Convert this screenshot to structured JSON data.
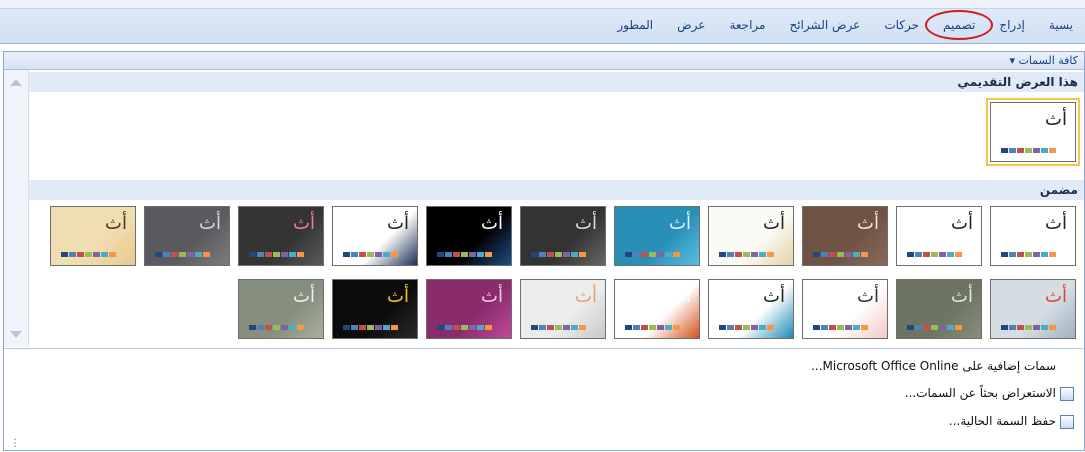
{
  "ribbon": {
    "tabs": [
      {
        "id": "home",
        "label": "يسية"
      },
      {
        "id": "insert",
        "label": "إدراج"
      },
      {
        "id": "design",
        "label": "تصميم"
      },
      {
        "id": "animations",
        "label": "حركات"
      },
      {
        "id": "slideshow",
        "label": "عرض الشرائح"
      },
      {
        "id": "review",
        "label": "مراجعة"
      },
      {
        "id": "view",
        "label": "عرض"
      },
      {
        "id": "developer",
        "label": "المطور"
      }
    ],
    "active_tab": "تصميم",
    "highlight_color": "#d01c1c"
  },
  "gallery": {
    "header": "كافة السمات ▾",
    "section_this": "هذا العرض التقديمي",
    "section_builtin": "مضمن",
    "theme_glyph": "أث"
  },
  "themes_row1": [
    {
      "bg": "#ffffff",
      "fg": "#222222",
      "accent": "#ffffff"
    },
    {
      "bg": "#ffffff",
      "fg": "#222222",
      "accent": "#ffffff"
    },
    {
      "bg": "#6f5446",
      "fg": "#f0e6dc",
      "accent": "#8a6a58"
    },
    {
      "bg": "#fbfbf6",
      "fg": "#222222",
      "accent": "#e3d2a4"
    },
    {
      "bg": "#2a8fb6",
      "fg": "#dff3fb",
      "accent": "#58c0e2"
    },
    {
      "bg": "#333333",
      "fg": "#dddddd",
      "accent": "#666666"
    },
    {
      "bg": "#000000",
      "fg": "#ffffff",
      "accent": "#1f4e85"
    },
    {
      "bg": "#ffffff",
      "fg": "#222222",
      "accent": "#1c2f57"
    },
    {
      "bg": "#343434",
      "fg": "#e87fa0",
      "accent": "#5a5a5a"
    },
    {
      "bg": "#5b5b5f",
      "fg": "#d8d8d8",
      "accent": "#7b7b80"
    },
    {
      "bg": "#f1ddb2",
      "fg": "#4a3a22",
      "accent": "#e6c88a"
    }
  ],
  "themes_row2": [
    {
      "bg": "#d5dde3",
      "fg": "#e14040",
      "accent": "#9fb1bf"
    },
    {
      "bg": "#6e7462",
      "fg": "#e6e6da",
      "accent": "#888e7c"
    },
    {
      "bg": "#ffffff",
      "fg": "#333333",
      "accent": "#f5c9c2"
    },
    {
      "bg": "#ffffff",
      "fg": "#222222",
      "accent": "#1e88b8"
    },
    {
      "bg": "#ffffff",
      "fg": "#ffffff",
      "accent": "#d3501a"
    },
    {
      "bg": "#ececec",
      "fg": "#e8a06a",
      "accent": "#c8c8c8"
    },
    {
      "bg": "#8a2c6c",
      "fg": "#f2c8e6",
      "accent": "#c04a98"
    },
    {
      "bg": "#0b0b0b",
      "fg": "#f3c233",
      "accent": "#2a2a2a"
    },
    {
      "bg": "#868f7d",
      "fg": "#eeeeee",
      "accent": "#a6ae9d"
    }
  ],
  "menu": {
    "more_online": "سمات إضافية على Microsoft Office Online...",
    "browse": "الاستعراض بحثاً عن السمات...",
    "save": "حفظ السمة الحالية..."
  }
}
